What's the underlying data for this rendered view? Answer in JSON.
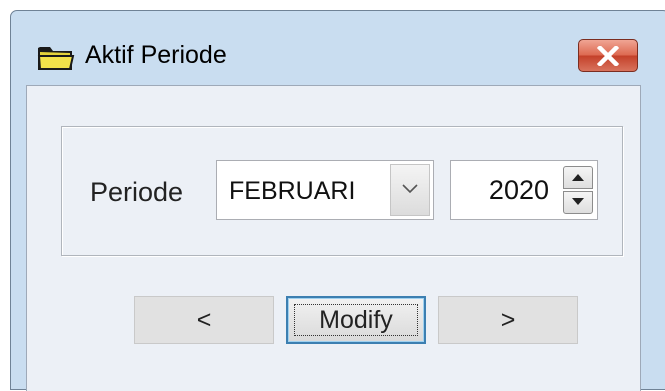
{
  "window": {
    "title": "Aktif Periode",
    "icon": "folder-icon",
    "close_icon": "close-icon"
  },
  "form": {
    "periode_label": "Periode",
    "month": "FEBRUARI",
    "year": "2020"
  },
  "buttons": {
    "prev_label": "<",
    "modify_label": "Modify",
    "next_label": ">"
  },
  "colors": {
    "frame": "#c9ddf0",
    "client": "#ecf0f6",
    "close_button": "#c4412a",
    "focus_border": "#3c7fb1"
  }
}
